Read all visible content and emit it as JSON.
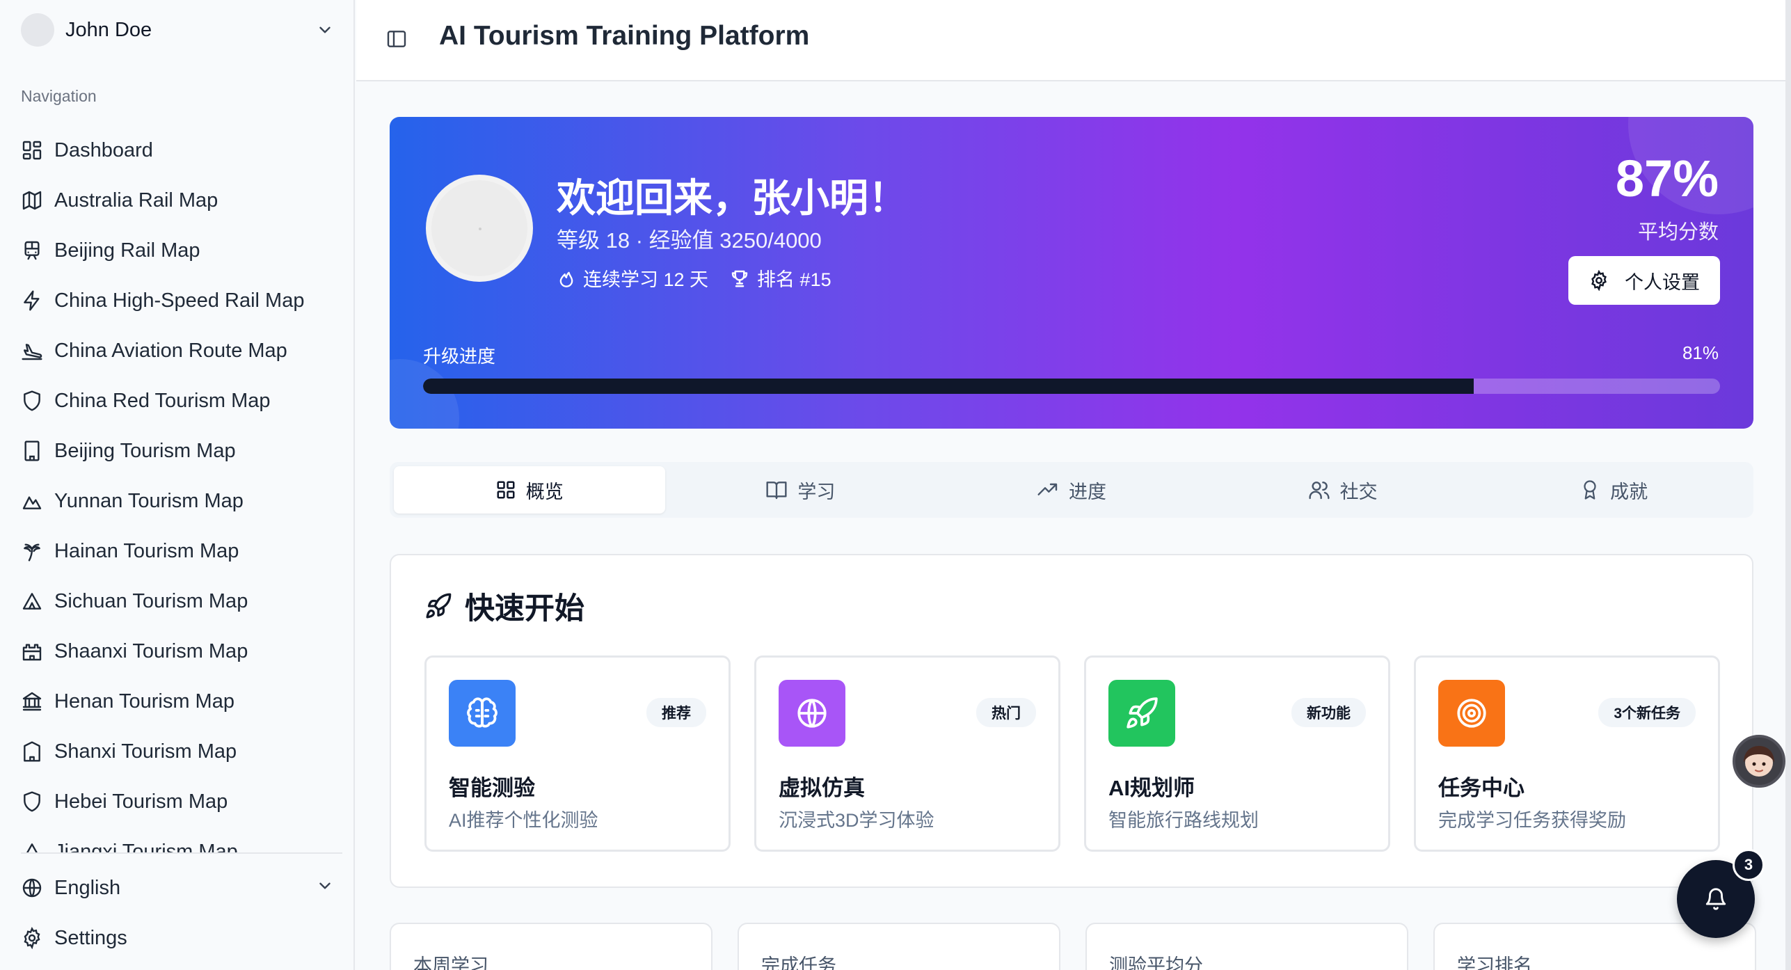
{
  "user": {
    "name": "John Doe"
  },
  "sidebar": {
    "nav_label": "Navigation",
    "items": [
      {
        "label": "Dashboard",
        "icon": "dashboard-icon"
      },
      {
        "label": "Australia Rail Map",
        "icon": "map-icon"
      },
      {
        "label": "Beijing Rail Map",
        "icon": "train-icon"
      },
      {
        "label": "China High-Speed Rail Map",
        "icon": "lightning-icon"
      },
      {
        "label": "China Aviation Route Map",
        "icon": "plane-landing-icon"
      },
      {
        "label": "China Red Tourism Map",
        "icon": "shield-icon"
      },
      {
        "label": "Beijing Tourism Map",
        "icon": "building-icon"
      },
      {
        "label": "Yunnan Tourism Map",
        "icon": "mountain-icon"
      },
      {
        "label": "Hainan Tourism Map",
        "icon": "palm-tree-icon"
      },
      {
        "label": "Sichuan Tourism Map",
        "icon": "tent-icon"
      },
      {
        "label": "Shaanxi Tourism Map",
        "icon": "castle-icon"
      },
      {
        "label": "Henan Tourism Map",
        "icon": "landmark-icon"
      },
      {
        "label": "Shanxi Tourism Map",
        "icon": "hotel-icon"
      },
      {
        "label": "Hebei Tourism Map",
        "icon": "shield-icon"
      },
      {
        "label": "Jiangxi Tourism Map",
        "icon": "tent-icon"
      }
    ],
    "language": "English",
    "settings": "Settings"
  },
  "header": {
    "title": "AI Tourism Training Platform"
  },
  "hero": {
    "welcome": "欢迎回来，张小明！",
    "level": "等级 18 · 经验值 3250/4000",
    "streak": "连续学习 12 天",
    "rank": "排名 #15",
    "score": "87%",
    "score_label": "平均分数",
    "settings_button": "个人设置",
    "progress_label": "升级进度",
    "progress_pct": "81%",
    "progress_value": 81
  },
  "tabs": [
    {
      "label": "概览",
      "icon": "grid-icon",
      "active": true
    },
    {
      "label": "学习",
      "icon": "book-icon",
      "active": false
    },
    {
      "label": "进度",
      "icon": "trending-up-icon",
      "active": false
    },
    {
      "label": "社交",
      "icon": "users-icon",
      "active": false
    },
    {
      "label": "成就",
      "icon": "award-icon",
      "active": false
    }
  ],
  "quick_start": {
    "title": "快速开始",
    "cards": [
      {
        "title": "智能测验",
        "desc": "AI推荐个性化测验",
        "badge": "推荐",
        "color": "#3b82f6",
        "icon": "brain-icon"
      },
      {
        "title": "虚拟仿真",
        "desc": "沉浸式3D学习体验",
        "badge": "热门",
        "color": "#a855f7",
        "icon": "globe-icon"
      },
      {
        "title": "AI规划师",
        "desc": "智能旅行路线规划",
        "badge": "新功能",
        "color": "#22c55e",
        "icon": "rocket-icon"
      },
      {
        "title": "任务中心",
        "desc": "完成学习任务获得奖励",
        "badge": "3个新任务",
        "color": "#f97316",
        "icon": "target-icon"
      }
    ]
  },
  "stats": [
    "本周学习",
    "完成任务",
    "测验平均分",
    "学习排名"
  ],
  "notifications": {
    "count": "3"
  }
}
